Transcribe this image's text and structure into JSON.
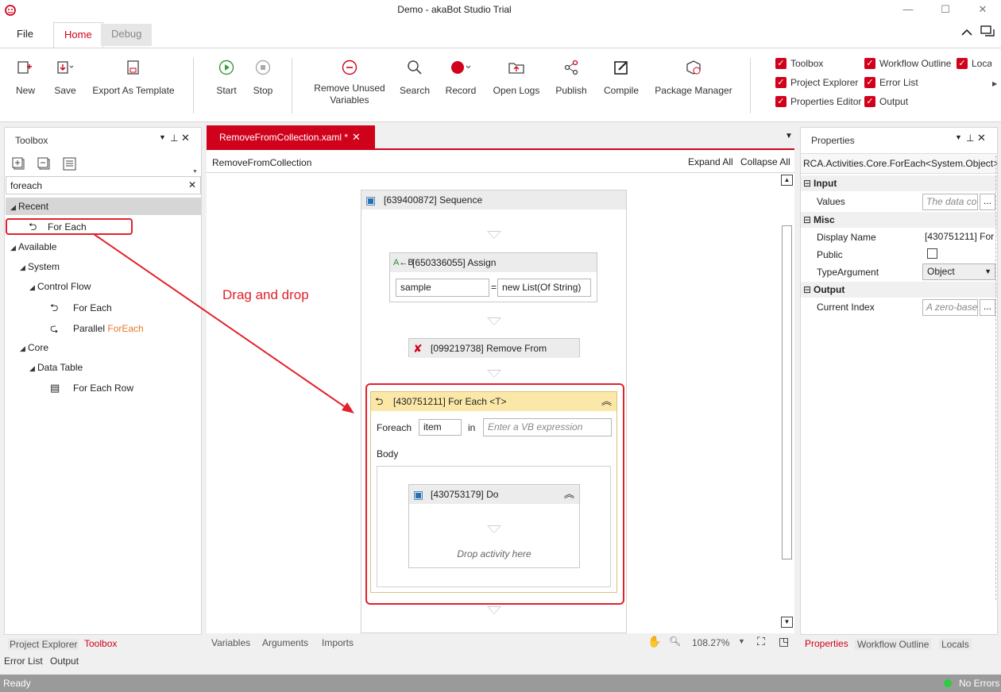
{
  "window": {
    "title": "Demo - akaBot Studio Trial"
  },
  "ribbon_tabs": [
    "File",
    "Home",
    "Debug"
  ],
  "ribbon_buttons": {
    "new": "New",
    "save": "Save",
    "export": "Export As Template",
    "start": "Start",
    "stop": "Stop",
    "remove_unused": "Remove Unused Variables",
    "search": "Search",
    "record": "Record",
    "open_logs": "Open Logs",
    "publish": "Publish",
    "compile": "Compile",
    "package_manager": "Package Manager"
  },
  "view_toggles": [
    "Toolbox",
    "Workflow Outline",
    "Loca",
    "Project Explorer",
    "Error List",
    "Properties Editor",
    "Output"
  ],
  "toolbox": {
    "title": "Toolbox",
    "search_value": "foreach",
    "recent": "Recent",
    "recent_item": "For Each",
    "available": "Available",
    "system": "System",
    "control_flow": "Control Flow",
    "for_each": "For Each",
    "parallel_prefix": "Parallel ",
    "parallel_highlight": "ForEach",
    "core": "Core",
    "data_table": "Data Table",
    "for_each_row": "For Each Row"
  },
  "annotation": {
    "text": "Drag and drop"
  },
  "designer": {
    "tab": "RemoveFromCollection.xaml *",
    "breadcrumb": "RemoveFromCollection",
    "expand_all": "Expand All",
    "collapse_all": "Collapse All",
    "sequence": "[639400872] Sequence",
    "assign": "[650336055] Assign",
    "assign_to": "sample",
    "assign_eq": "=",
    "assign_value": "new List(Of String)",
    "remove_from": "[099219738] Remove From",
    "foreach_title": "[430751211] For Each <T>",
    "foreach_label": "Foreach",
    "foreach_var": "item",
    "in_label": "in",
    "in_placeholder": "Enter a VB expression",
    "body_label": "Body",
    "do_title": "[430753179] Do",
    "drop_hint": "Drop activity here",
    "bottom_tabs": [
      "Variables",
      "Arguments",
      "Imports"
    ],
    "zoom": "108.27%"
  },
  "properties": {
    "title": "Properties",
    "type": "RCA.Activities.Core.ForEach<System.Object>",
    "cat_input": "Input",
    "values_key": "Values",
    "values_placeholder": "The data co",
    "cat_misc": "Misc",
    "display_name_key": "Display Name",
    "display_name_val": "[430751211] For",
    "public_key": "Public",
    "type_arg_key": "TypeArgument",
    "type_arg_val": "Object",
    "cat_output": "Output",
    "current_index_key": "Current Index",
    "current_index_placeholder": "A zero-base",
    "ellipsis": "...",
    "bottom_tabs": [
      "Properties",
      "Workflow Outline",
      "Locals"
    ]
  },
  "left_bottom_tabs": [
    "Project Explorer",
    "Toolbox"
  ],
  "output_tabs": [
    "Error List",
    "Output"
  ],
  "status": {
    "left": "Ready",
    "right": "No Errors"
  },
  "colors": {
    "accent": "#d0021b",
    "status_ok": "#2ecc40"
  }
}
